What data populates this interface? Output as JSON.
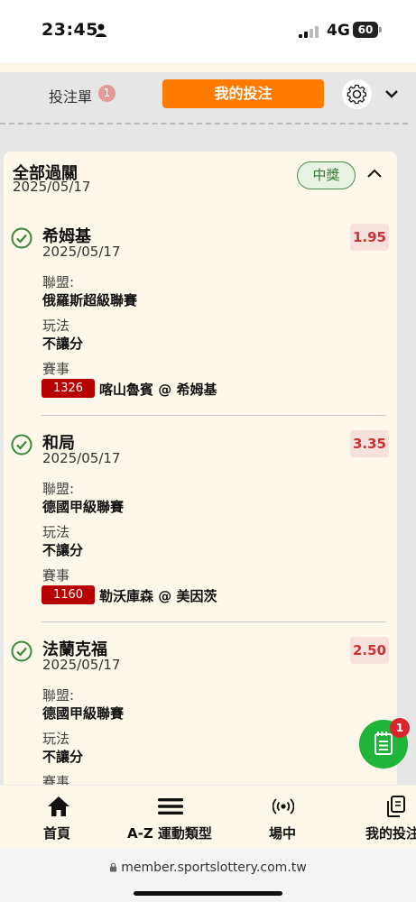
{
  "status_bar": {
    "time": "23:45",
    "network": "4G",
    "battery": "60"
  },
  "slip_header": {
    "tab_label": "投注單",
    "tab_count": "1",
    "my_bets_label": "我的投注"
  },
  "card": {
    "title": "全部過關",
    "date": "2025/05/17",
    "status": "中獎"
  },
  "labels": {
    "league": "聯盟:",
    "play": "玩法",
    "event": "賽事"
  },
  "bets": [
    {
      "team": "希姆基",
      "date": "2025/05/17",
      "odds": "1.95",
      "league": "俄羅斯超級聯賽",
      "play": "不讓分",
      "match_id": "1326",
      "match_name": "喀山魯賓 @ 希姆基"
    },
    {
      "team": "和局",
      "date": "2025/05/17",
      "odds": "3.35",
      "league": "德國甲級聯賽",
      "play": "不讓分",
      "match_id": "1160",
      "match_name": "勒沃庫森 @ 美因茨"
    },
    {
      "team": "法蘭克福",
      "date": "2025/05/17",
      "odds": "2.50",
      "league": "德國甲級聯賽",
      "play": "不讓分"
    }
  ],
  "fab": {
    "icon": "notepad-icon",
    "badge": "1"
  },
  "bottom_nav": {
    "items": [
      {
        "label": "首頁",
        "icon": "home-icon"
      },
      {
        "label": "A-Z 運動類型",
        "icon": "menu-icon"
      },
      {
        "label": "場中",
        "icon": "live-icon"
      },
      {
        "label": "我的投注",
        "icon": "copy-icon"
      }
    ]
  },
  "browser": {
    "url": "member.sportslottery.com.tw"
  },
  "colors": {
    "accent": "#ff7a00",
    "win": "#2e7a2e",
    "odds": "#cc3333",
    "match_id_bg": "#b70000",
    "fab": "#1eb53a"
  }
}
